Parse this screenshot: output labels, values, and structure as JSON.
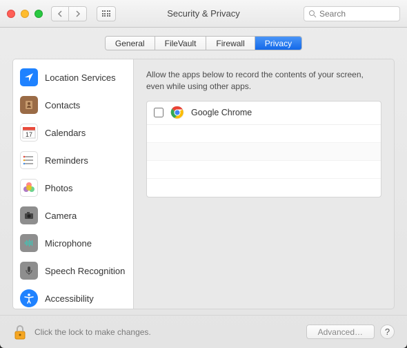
{
  "window": {
    "title": "Security & Privacy"
  },
  "search": {
    "placeholder": "Search"
  },
  "tabs": [
    {
      "label": "General",
      "active": false
    },
    {
      "label": "FileVault",
      "active": false
    },
    {
      "label": "Firewall",
      "active": false
    },
    {
      "label": "Privacy",
      "active": true
    }
  ],
  "sidebar": {
    "items": [
      {
        "label": "Location Services",
        "icon": "location",
        "bg": "#1f82ff"
      },
      {
        "label": "Contacts",
        "icon": "contacts",
        "bg": "#b07b4c"
      },
      {
        "label": "Calendars",
        "icon": "calendar",
        "bg": "#ffffff"
      },
      {
        "label": "Reminders",
        "icon": "reminders",
        "bg": "#ffffff"
      },
      {
        "label": "Photos",
        "icon": "photos",
        "bg": "#ffffff"
      },
      {
        "label": "Camera",
        "icon": "camera",
        "bg": "#8e8e8e"
      },
      {
        "label": "Microphone",
        "icon": "microphone",
        "bg": "#8e8e8e"
      },
      {
        "label": "Speech Recognition",
        "icon": "speech",
        "bg": "#8e8e8e"
      },
      {
        "label": "Accessibility",
        "icon": "accessibility",
        "bg": "#1f82ff"
      }
    ]
  },
  "content": {
    "description": "Allow the apps below to record the contents of your screen, even while using other apps.",
    "apps": [
      {
        "name": "Google Chrome",
        "checked": false,
        "icon": "chrome"
      }
    ]
  },
  "footer": {
    "lock_text": "Click the lock to make changes.",
    "advanced_label": "Advanced…",
    "help_label": "?"
  }
}
